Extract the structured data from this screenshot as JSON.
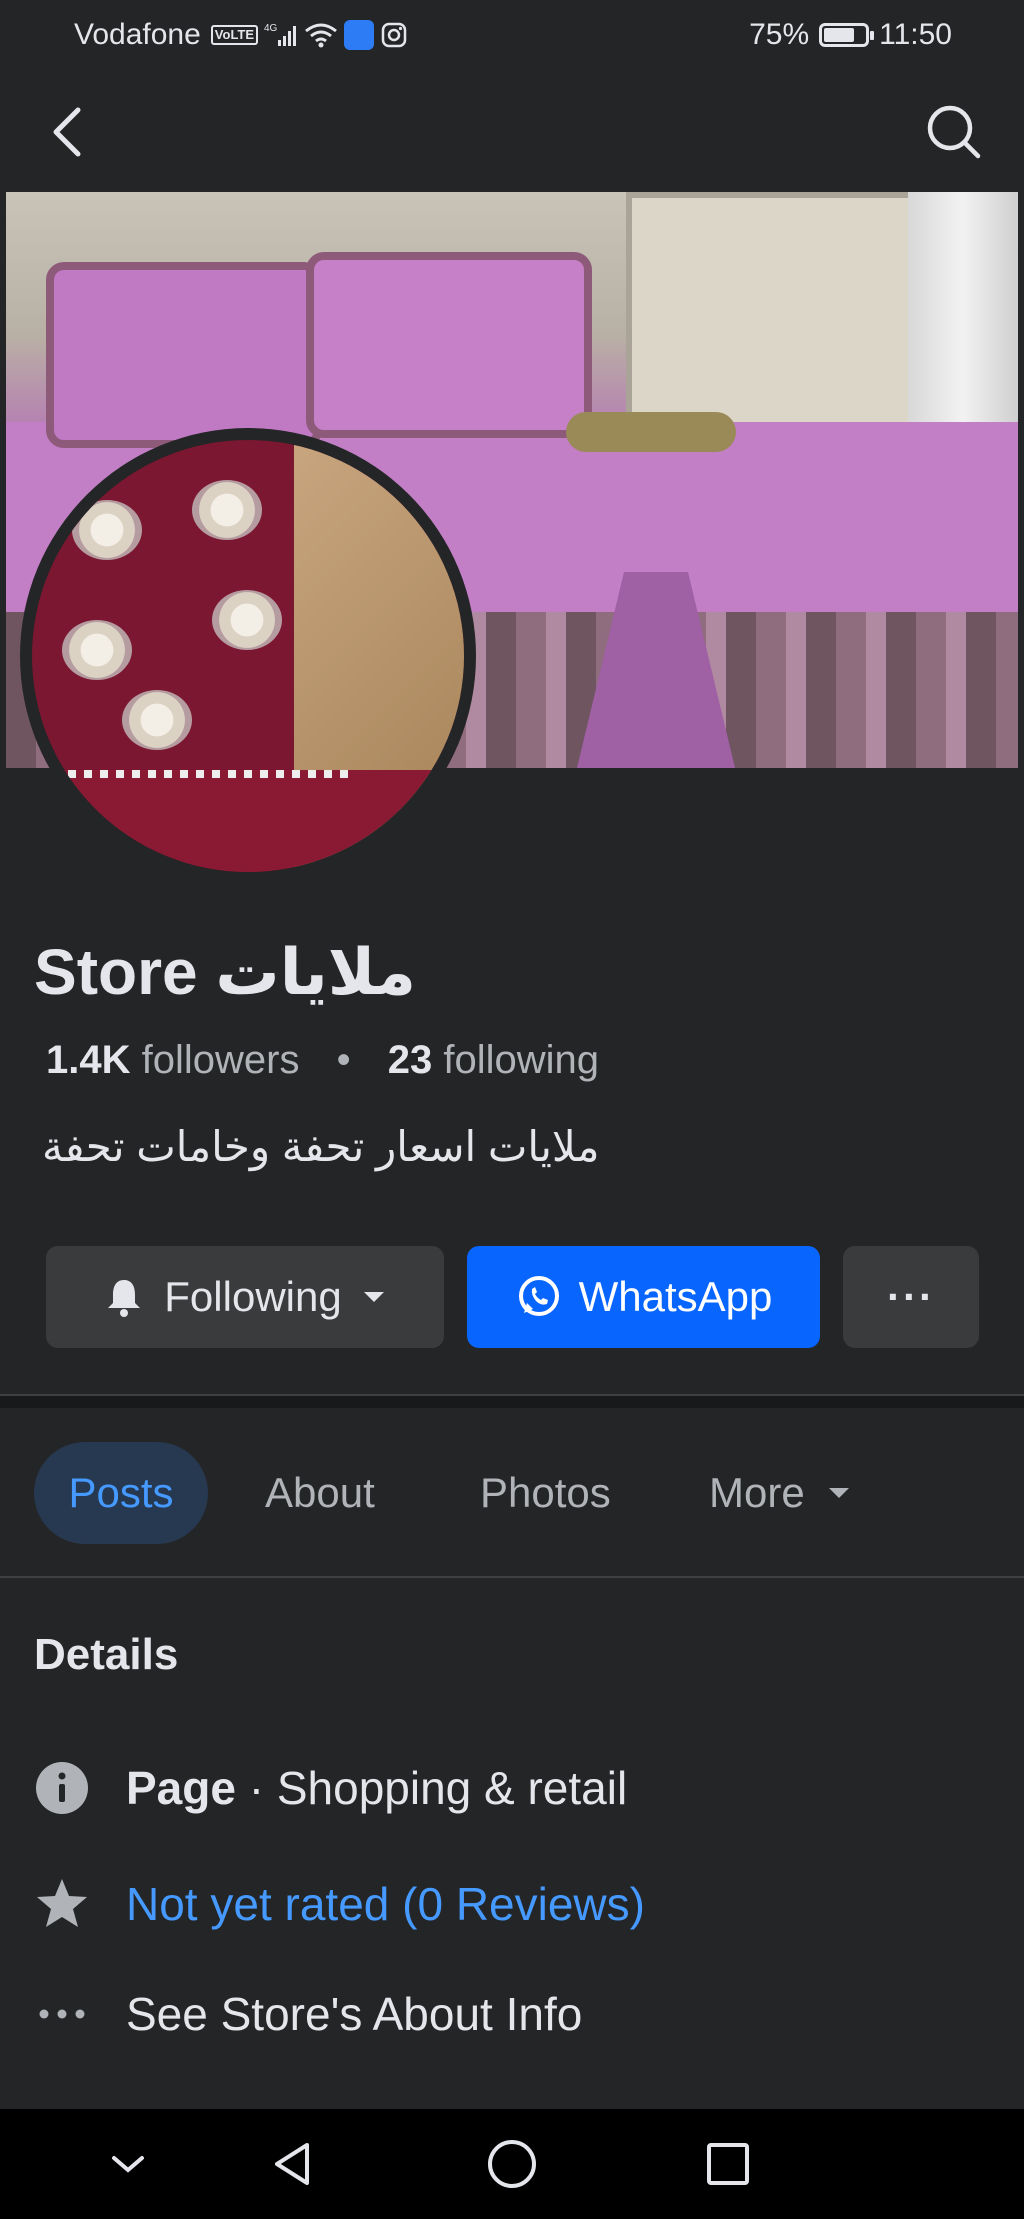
{
  "status_bar": {
    "carrier": "Vodafone",
    "volte": "VoLTE",
    "network": "4G",
    "battery_text": "75%",
    "battery_level": 0.75,
    "time": "11:50"
  },
  "page": {
    "name": "Store ملايات",
    "followers_count": "1.4K",
    "followers_label": "followers",
    "separator": "•",
    "following_count": "23",
    "following_label": "following",
    "bio": "ملايات اسعار تحفة وخامات تحفة"
  },
  "actions": {
    "following_label": "Following",
    "whatsapp_label": "WhatsApp",
    "more_label": "···"
  },
  "tabs": [
    {
      "label": "Posts",
      "active": true
    },
    {
      "label": "About",
      "active": false
    },
    {
      "label": "Photos",
      "active": false
    },
    {
      "label": "More",
      "active": false
    }
  ],
  "details": {
    "title": "Details",
    "category_prefix": "Page",
    "category_sep": " · ",
    "category": "Shopping & retail",
    "rating": "Not yet rated (0 Reviews)",
    "about_link": "See Store's About Info"
  },
  "colors": {
    "background": "#242526",
    "accent": "#0866ff",
    "link": "#4599ff",
    "active_tab_bg": "#263951"
  },
  "icons": {
    "back": "back-arrow-icon",
    "search": "search-icon",
    "bell": "bell-icon",
    "whatsapp": "whatsapp-icon",
    "info": "info-icon",
    "star": "star-icon",
    "dots": "more-dots-icon"
  }
}
